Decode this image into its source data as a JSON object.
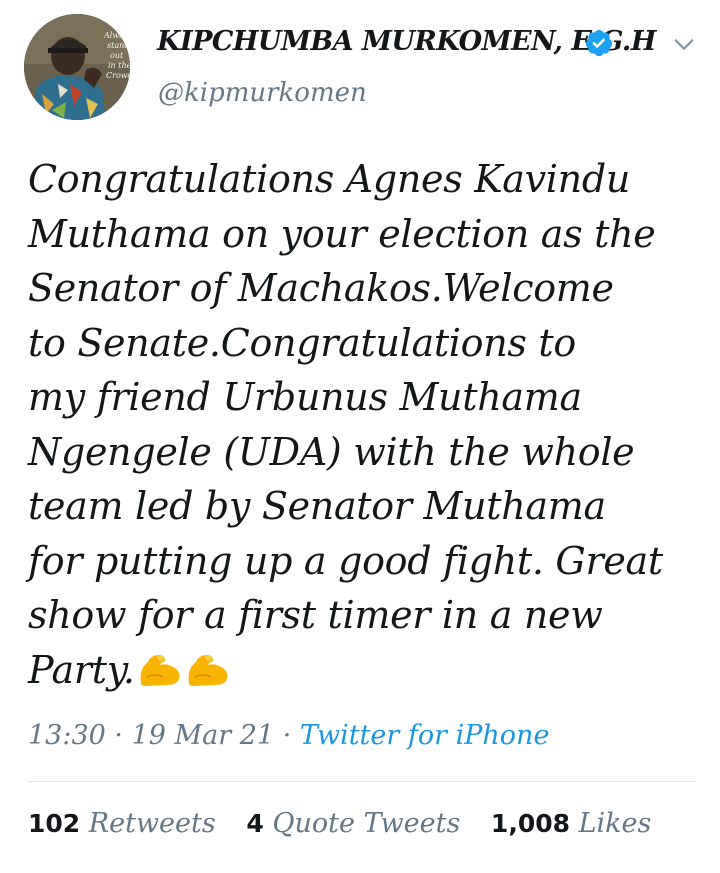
{
  "author": {
    "display_name": "KIPCHUMBA MURKOMEN, E.G.H",
    "handle": "@kipmurkomen",
    "verified": true,
    "avatar_text": [
      "Always",
      "stand",
      "out",
      "in the",
      "Crowd"
    ]
  },
  "tweet": {
    "lines": [
      "Congratulations Agnes Kavindu",
      "Muthama on your election as the",
      "Senator of Machakos.Welcome",
      "to Senate.Congratulations to",
      "my friend Urbunus Muthama",
      "Ngengele (UDA) with the whole",
      "team led by Senator Muthama",
      "for putting up a good fight. Great",
      "show for a first timer in a new",
      "Party."
    ],
    "emojis": [
      "flexed-biceps",
      "flexed-biceps"
    ]
  },
  "meta": {
    "time": "13:30",
    "separator": "·",
    "date": "19 Mar 21",
    "source": "Twitter for iPhone"
  },
  "stats": {
    "retweets_count": "102",
    "retweets_label": "Retweets",
    "quotes_count": "4",
    "quotes_label": "Quote Tweets",
    "likes_count": "1,008",
    "likes_label": "Likes"
  },
  "colors": {
    "text": "#14171a",
    "secondary": "#657786",
    "link": "#1b95e0",
    "verified": "#1da1f2",
    "divider": "#dfe3e6"
  }
}
